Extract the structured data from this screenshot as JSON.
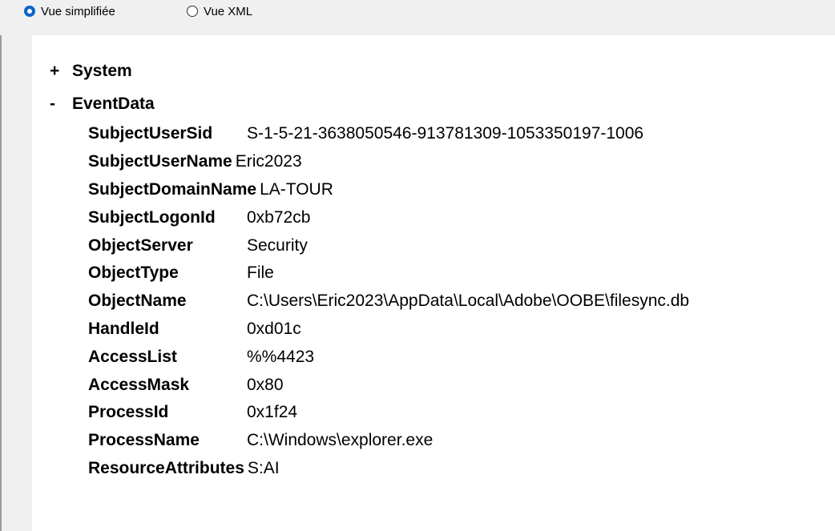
{
  "view_options": {
    "simplified": {
      "label": "Vue simplifiée",
      "selected": true
    },
    "xml": {
      "label": "Vue XML",
      "selected": false
    }
  },
  "tree": {
    "system": {
      "toggle": "+",
      "label": "System"
    },
    "eventdata": {
      "toggle": "-",
      "label": "EventData"
    }
  },
  "fields": [
    {
      "key": "SubjectUserSid",
      "value": "S-1-5-21-3638050546-913781309-1053350197-1006",
      "wide": false
    },
    {
      "key": "SubjectUserName",
      "value": "Eric2023",
      "wide": true
    },
    {
      "key": "SubjectDomainName",
      "value": "LA-TOUR",
      "wide": true
    },
    {
      "key": "SubjectLogonId",
      "value": "0xb72cb",
      "wide": false
    },
    {
      "key": "ObjectServer",
      "value": "Security",
      "wide": false
    },
    {
      "key": "ObjectType",
      "value": "File",
      "wide": false
    },
    {
      "key": "ObjectName",
      "value": "C:\\Users\\Eric2023\\AppData\\Local\\Adobe\\OOBE\\filesync.db",
      "wide": false
    },
    {
      "key": "HandleId",
      "value": "0xd01c",
      "wide": false
    },
    {
      "key": "AccessList",
      "value": "%%4423",
      "wide": false
    },
    {
      "key": "AccessMask",
      "value": "0x80",
      "wide": false
    },
    {
      "key": "ProcessId",
      "value": "0x1f24",
      "wide": false
    },
    {
      "key": "ProcessName",
      "value": "C:\\Windows\\explorer.exe",
      "wide": false
    },
    {
      "key": "ResourceAttributes",
      "value": "S:AI",
      "wide": true
    }
  ],
  "colors": {
    "accent": "#0a64c8",
    "background": "#f0f0f0",
    "panel": "#ffffff"
  }
}
